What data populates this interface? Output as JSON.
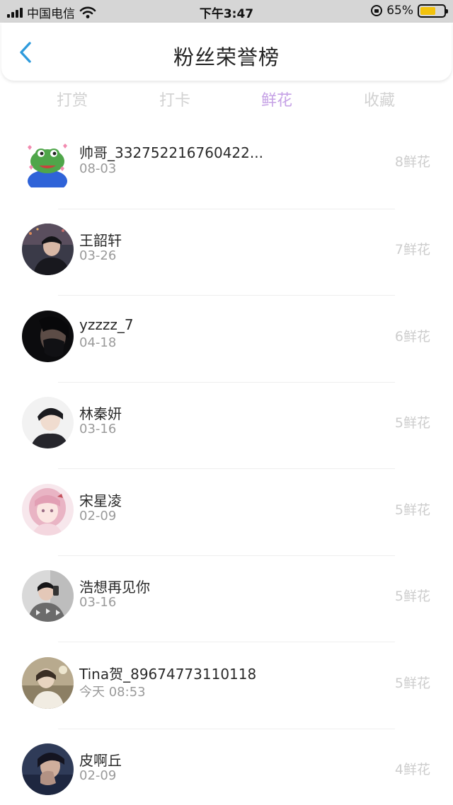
{
  "status_bar": {
    "carrier": "中国电信",
    "time": "下午3:47",
    "battery_percent": "65%",
    "battery_level": 0.65,
    "icons": [
      "signal-icon",
      "wifi-icon",
      "rotation-lock-icon",
      "battery-icon"
    ]
  },
  "header": {
    "title": "粉丝荣誉榜",
    "back_icon": "chevron-left-icon",
    "accent_color": "#2f9bdc"
  },
  "tabs": [
    {
      "label": "打赏",
      "active": false
    },
    {
      "label": "打卡",
      "active": false
    },
    {
      "label": "鲜花",
      "active": true
    },
    {
      "label": "收藏",
      "active": false
    }
  ],
  "active_tab_color": "#c6a2e6",
  "fans": [
    {
      "name": "帅哥_332752216760422...",
      "date": "08-03",
      "count": "8鲜花",
      "avatar": "frog-sticker-avatar"
    },
    {
      "name": "王韶轩",
      "date": "03-26",
      "count": "7鲜花",
      "avatar": "photo-avatar"
    },
    {
      "name": "yzzzz_7",
      "date": "04-18",
      "count": "6鲜花",
      "avatar": "photo-avatar"
    },
    {
      "name": "林秦妍",
      "date": "03-16",
      "count": "5鲜花",
      "avatar": "photo-avatar"
    },
    {
      "name": "宋星凌",
      "date": "02-09",
      "count": "5鲜花",
      "avatar": "anime-avatar"
    },
    {
      "name": "浩想再见你",
      "date": "03-16",
      "count": "5鲜花",
      "avatar": "photo-avatar"
    },
    {
      "name": "Tina贺_89674773110118",
      "date": "今天 08:53",
      "count": "5鲜花",
      "avatar": "photo-avatar"
    },
    {
      "name": "皮啊丘",
      "date": "02-09",
      "count": "4鲜花",
      "avatar": "photo-avatar"
    }
  ]
}
